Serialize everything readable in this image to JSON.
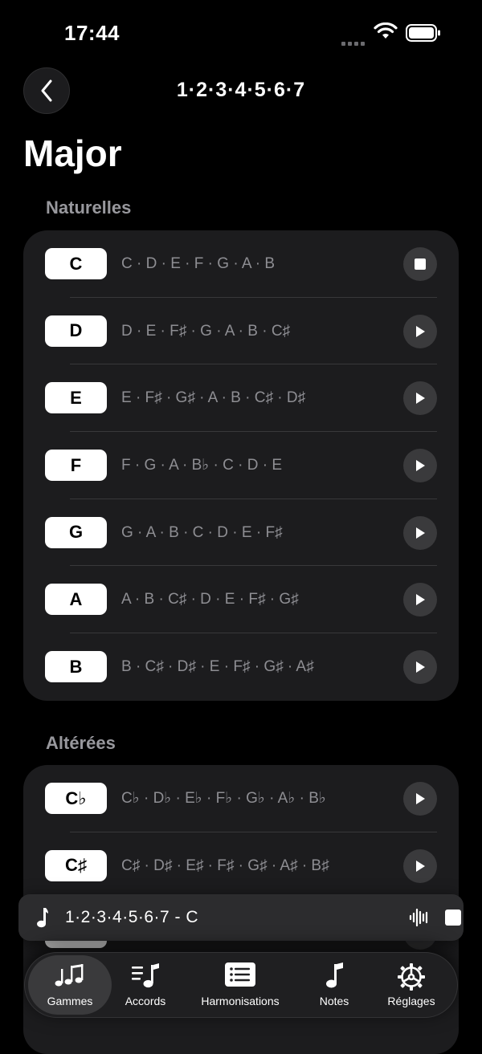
{
  "status": {
    "time": "17:44"
  },
  "header": {
    "title": "1·2·3·4·5·6·7"
  },
  "page": {
    "title": "Major"
  },
  "sections": {
    "natural": {
      "label": "Naturelles",
      "rows": [
        {
          "key": "C",
          "notes": "C · D · E · F · G · A · B",
          "state": "stop"
        },
        {
          "key": "D",
          "notes": "D · E · F♯ · G · A · B · C♯",
          "state": "play"
        },
        {
          "key": "E",
          "notes": "E · F♯ · G♯ · A · B · C♯ · D♯",
          "state": "play"
        },
        {
          "key": "F",
          "notes": "F · G · A · B♭ · C · D · E",
          "state": "play"
        },
        {
          "key": "G",
          "notes": "G · A · B · C · D · E · F♯",
          "state": "play"
        },
        {
          "key": "A",
          "notes": "A · B · C♯ · D · E · F♯ · G♯",
          "state": "play"
        },
        {
          "key": "B",
          "notes": "B · C♯ · D♯ · E · F♯ · G♯ · A♯",
          "state": "play"
        }
      ]
    },
    "altered": {
      "label": "Altérées",
      "rows": [
        {
          "key": "C♭",
          "notes": "C♭ · D♭ · E♭ · F♭ · G♭ · A♭ · B♭",
          "state": "play"
        },
        {
          "key": "C♯",
          "notes": "C♯ · D♯ · E♯ · F♯ · G♯ · A♯ · B♯",
          "state": "play"
        }
      ]
    }
  },
  "now_playing": {
    "text": "1·2·3·4·5·6·7 - C",
    "icon": "music-note-icon"
  },
  "tabs": [
    {
      "label": "Gammes",
      "icon": "notes-icon",
      "active": true
    },
    {
      "label": "Accords",
      "icon": "chords-icon"
    },
    {
      "label": "Harmonisations",
      "icon": "list-icon"
    },
    {
      "label": "Notes",
      "icon": "music-note-icon"
    },
    {
      "label": "Réglages",
      "icon": "gear-icon"
    }
  ],
  "colors": {
    "background": "#000000",
    "card": "#1c1c1e",
    "key_bg": "#ffffff",
    "secondary_text": "#8e8e93"
  }
}
